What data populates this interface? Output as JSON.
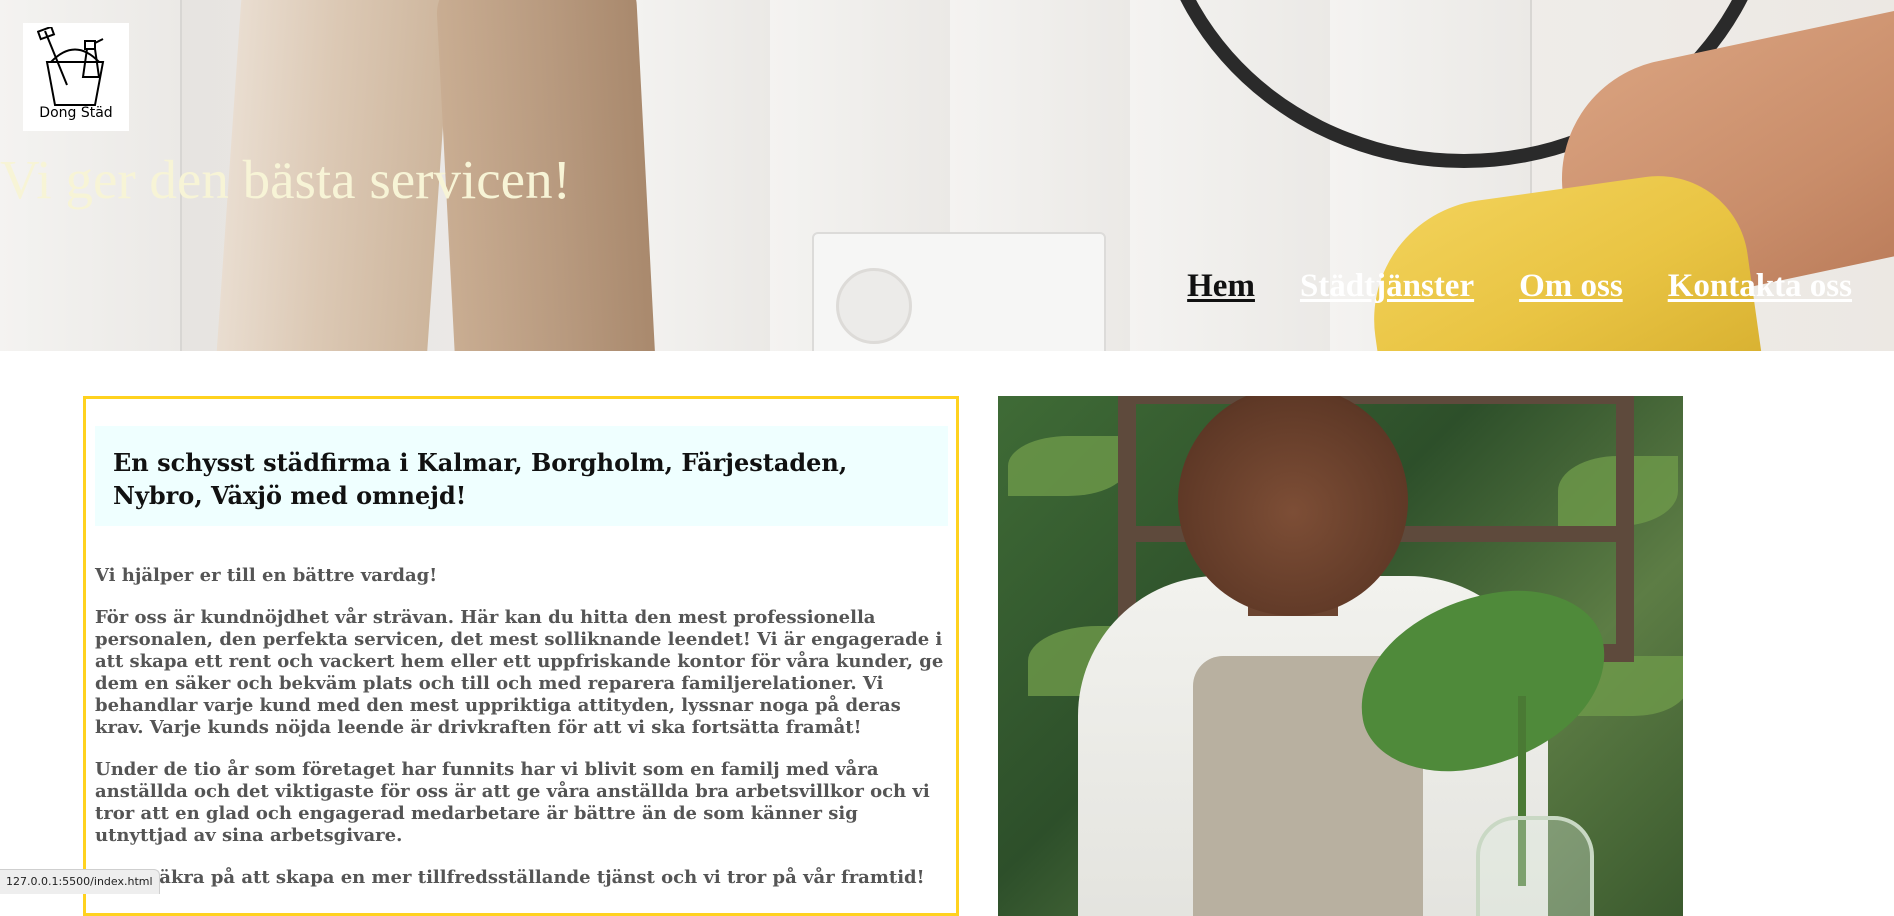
{
  "hero": {
    "logo_text": "Dong Städ",
    "title": "Vi ger den bästa servicen!"
  },
  "nav": {
    "items": [
      {
        "label": "Hem",
        "active": true
      },
      {
        "label": "Städtjänster",
        "active": false
      },
      {
        "label": "Om oss",
        "active": false
      },
      {
        "label": "Kontakta oss",
        "active": false
      }
    ]
  },
  "main": {
    "callout_heading": "En schysst städfirma i Kalmar, Borgholm, Färjestaden, Nybro, Växjö med omnejd!",
    "paragraphs": [
      "Vi hjälper er till en bättre vardag!",
      "För oss är kundnöjdhet vår strävan. Här kan du hitta den mest professionella personalen, den perfekta servicen, det mest solliknande leendet! Vi är engagerade i att skapa ett rent och vackert hem eller ett uppfriskande kontor för våra kunder, ge dem en säker och bekväm plats och till och med reparera familjerelationer. Vi behandlar varje kund med den mest uppriktiga attityden, lyssnar noga på deras krav. Varje kunds nöjda leende är drivkraften för att vi ska fortsätta framåt!",
      "Under de tio år som företaget har funnits har vi blivit som en familj med våra anställda och det viktigaste för oss är att ge våra anställda bra arbetsvillkor och vi tror att en glad och engagerad medarbetare är bättre än de som känner sig utnyttjad av sina arbetsgivare.",
      "Vi är säkra på att skapa en mer tillfredsställande tjänst och vi tror på vår framtid!"
    ]
  },
  "status_bar": {
    "url": "127.0.0.1:5500/index.html"
  },
  "colors": {
    "hero_title": "#f7f4d6",
    "box_border": "#ffd21f",
    "callout_bg": "#efffff",
    "body_text": "#555555",
    "nav_active": "#111111",
    "nav_inactive": "#ffffff"
  }
}
